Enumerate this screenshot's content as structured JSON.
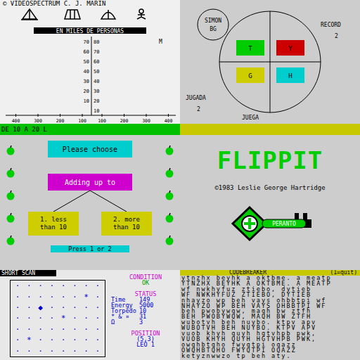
{
  "chart": {
    "copyright": "© VIDEOSPECTRUM C. J. MARIN",
    "title": "EN MILES DE PERSONAS",
    "y_ticks_left": [
      "70",
      "60",
      "50",
      "40",
      "30",
      "20",
      "10"
    ],
    "y_ticks_right": [
      "80",
      "70",
      "60",
      "50",
      "40",
      "30",
      "20",
      "10"
    ],
    "x_ticks": [
      "400",
      "300",
      "200",
      "100",
      "100",
      "200",
      "300",
      "400"
    ],
    "unit": "M",
    "range": "DE 10 A 20 L"
  },
  "simon": {
    "badge": [
      "SIMON",
      "BG"
    ],
    "pads": [
      {
        "key": "T",
        "color": "#00cd00"
      },
      {
        "key": "Y",
        "color": "#cd0000"
      },
      {
        "key": "G",
        "color": "#cdcd00"
      },
      {
        "key": "H",
        "color": "#00cdcd"
      }
    ],
    "record_label": "RECORD",
    "record": "2",
    "turn_label": "JUGADA",
    "turn": "2",
    "status": "JUEGA"
  },
  "quiz": {
    "prompt": "Please choose",
    "question": "Adding up to",
    "options": [
      {
        "lines": [
          "1. less",
          "than 10"
        ]
      },
      {
        "lines": [
          "2. more",
          "than 10"
        ]
      }
    ],
    "hint": "Press 1 or 2"
  },
  "flippit": {
    "title": "FLIPPIT",
    "credit": "©1983 Leslie George Hartridge",
    "publisher": "PERANTO"
  },
  "scan": {
    "title": "SHORT SCAN",
    "grid": [
      "········",
      "······*·",
      "··◆·····",
      "····*···",
      "········",
      "·*······",
      "········"
    ],
    "condition_label": "CONDITION",
    "condition": "OK",
    "status_label": "STATUS",
    "stats": [
      {
        "label": "Time",
        "value": "149"
      },
      {
        "label": "Energy",
        "value": "5000"
      },
      {
        "label": "Torpedo",
        "value": "10"
      },
      {
        "label": "* & ¤",
        "value": "31"
      },
      {
        "label": "Ω",
        "value": "3"
      }
    ],
    "position_label": "POSITION",
    "position": "(5,3)",
    "quadrant": "LEO",
    "quadrant_number": "1"
  },
  "codebreaker": {
    "title": "CODEBREAKER",
    "hint": "(1=quit)",
    "lines": [
      "ytnzhx beyhk a oktbme. a meatp",
      "YTNZHX BEYHK A OKTBME. A MEATP",
      "wf nwkhyfuz ztiebo, dytieb",
      "WF NWKHYFUZ ZTIEBO, DYTIEB",
      "nhayzo wp beh vays ohbbtpi wf",
      "NHAYZO WP BEH VAYS OHBBTPI WF",
      "beh pwobywqw, maqh bw ztfh",
      "BEH PWOBYWQW, MAQH BW ZTFH",
      "wubotvh beh nuybo. ktpv apv",
      "WUBOTVH BEH NUYBO. KTPV APV",
      "vuob khyh quyh hgtvhpb pwk,",
      "VUOB KHYH QUYH HGTVHPB PWK,",
      "owqhbtqho fwyqtpi oqazz",
      "OWQHBTQHO FWYQTPI OQAZZ",
      "ketyznwwzo tp beh aty."
    ]
  }
}
